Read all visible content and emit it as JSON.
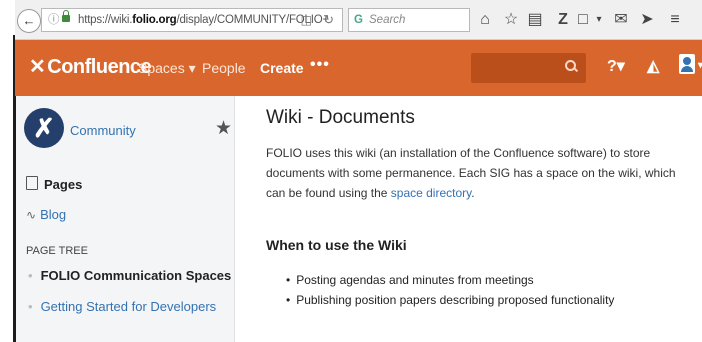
{
  "browser": {
    "url_prefix": "https://wiki.",
    "url_domain": "folio.org",
    "url_suffix": "/display/COMMUNITY/FOLIO+",
    "search_placeholder": "Search",
    "icons": [
      "back-arrow-icon",
      "info-icon",
      "lock-icon",
      "reader-icon",
      "reload-icon",
      "home-icon",
      "bookmark-star-icon",
      "reading-list-icon",
      "zotero-icon",
      "pocket-icon",
      "mail-icon",
      "send-icon",
      "menu-icon"
    ]
  },
  "header": {
    "logo": "Confluence",
    "logo_mark": "✕",
    "spaces": "Spaces ▾",
    "people": "People",
    "create": "Create",
    "more": "•••",
    "help": "?▾",
    "bg_color": "#d9672d"
  },
  "sidebar": {
    "space_name": "Community",
    "pages": "Pages",
    "blog": "Blog",
    "page_tree_heading": "PAGE TREE",
    "tree_items": [
      "FOLIO Communication Spaces",
      "Getting Started for Developers"
    ]
  },
  "main": {
    "title": "Wiki - Documents",
    "para_text": "FOLIO uses this wiki (an installation of the Confluence software) to store documents with some permanence.  Each SIG has a space on the wiki, which can be found using the ",
    "para_link": "space directory",
    "para_end": ".",
    "heading": "When to use the Wiki",
    "bullets": [
      "Posting agendas and minutes from meetings",
      "Publishing position papers describing proposed functionality"
    ]
  }
}
